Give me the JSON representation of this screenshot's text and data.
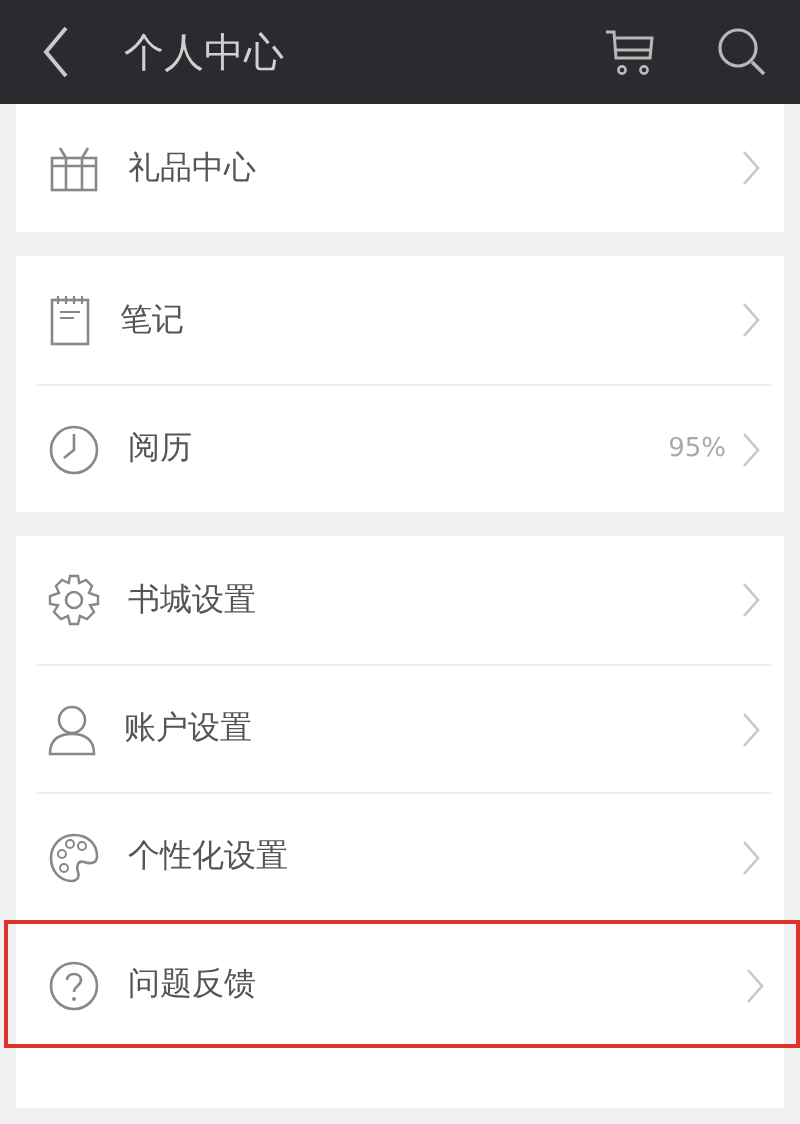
{
  "header": {
    "title": "个人中心"
  },
  "groups": [
    {
      "items": [
        {
          "kind": "gift",
          "label": "礼品中心",
          "highlighted": false
        }
      ]
    },
    {
      "items": [
        {
          "kind": "notepad",
          "label": "笔记",
          "highlighted": false
        },
        {
          "kind": "clock",
          "label": "阅历",
          "value": "95%",
          "highlighted": false
        }
      ]
    },
    {
      "items": [
        {
          "kind": "gear",
          "label": "书城设置",
          "highlighted": false
        },
        {
          "kind": "person",
          "label": "账户设置",
          "highlighted": false
        },
        {
          "kind": "palette",
          "label": "个性化设置",
          "highlighted": false
        },
        {
          "kind": "question",
          "label": "问题反馈",
          "highlighted": true
        }
      ]
    }
  ]
}
